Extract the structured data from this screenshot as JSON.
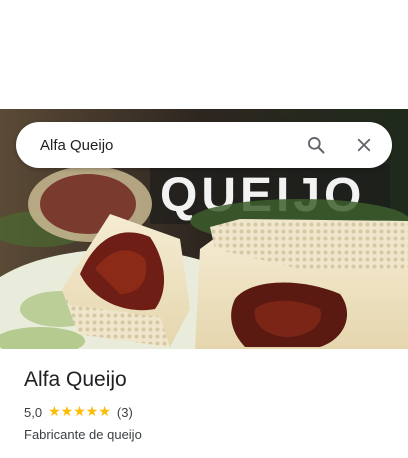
{
  "search": {
    "query": "Alfa Queijo",
    "search_icon": "search-icon",
    "close_icon": "close-icon"
  },
  "photo": {
    "sign_text": "QUEIJO"
  },
  "place": {
    "name": "Alfa Queijo",
    "rating": "5,0",
    "stars": 5,
    "review_count": "(3)",
    "category": "Fabricante de queijo"
  },
  "colors": {
    "star": "#fbbc04",
    "title": "#202124",
    "secondary_text": "#3c4043"
  }
}
